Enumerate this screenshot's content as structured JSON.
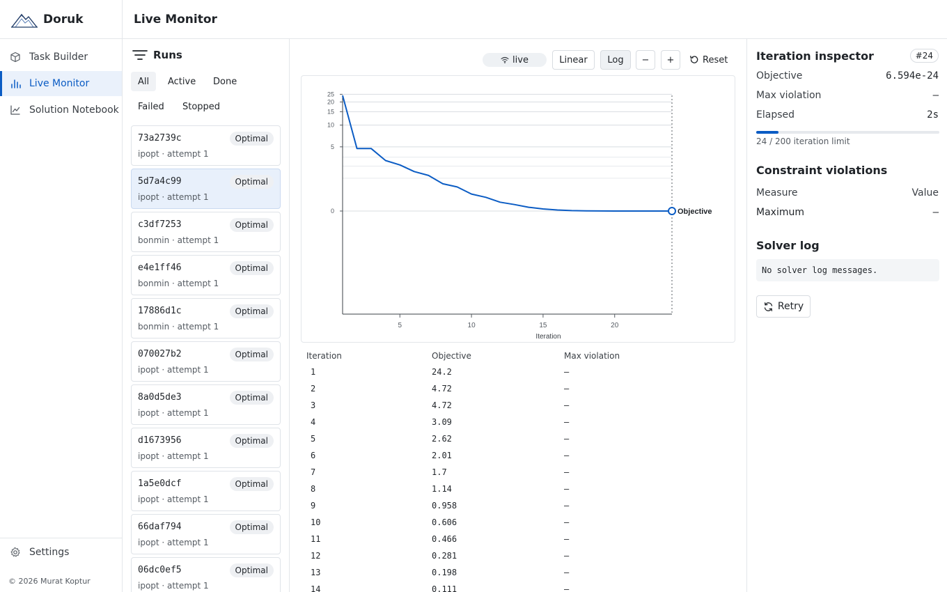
{
  "app": {
    "name": "Doruk"
  },
  "nav": {
    "items": [
      {
        "label": "Task Builder",
        "icon": "cube-icon"
      },
      {
        "label": "Live Monitor",
        "icon": "bar-chart-icon"
      },
      {
        "label": "Solution Notebook",
        "icon": "line-chart-icon"
      }
    ],
    "active_index": 1,
    "settings_label": "Settings",
    "copyright": "© 2026 Murat Koptur"
  },
  "header": {
    "title": "Live Monitor"
  },
  "runs": {
    "title": "Runs",
    "filters": [
      "All",
      "Active",
      "Done",
      "Failed",
      "Stopped"
    ],
    "active_filter": "All",
    "selected_index": 1,
    "items": [
      {
        "id": "73a2739c",
        "meta": "ipopt · attempt 1",
        "status": "Optimal"
      },
      {
        "id": "5d7a4c99",
        "meta": "ipopt · attempt 1",
        "status": "Optimal"
      },
      {
        "id": "c3df7253",
        "meta": "bonmin · attempt 1",
        "status": "Optimal"
      },
      {
        "id": "e4e1ff46",
        "meta": "bonmin · attempt 1",
        "status": "Optimal"
      },
      {
        "id": "17886d1c",
        "meta": "bonmin · attempt 1",
        "status": "Optimal"
      },
      {
        "id": "070027b2",
        "meta": "ipopt · attempt 1",
        "status": "Optimal"
      },
      {
        "id": "8a0d5de3",
        "meta": "ipopt · attempt 1",
        "status": "Optimal"
      },
      {
        "id": "d1673956",
        "meta": "ipopt · attempt 1",
        "status": "Optimal"
      },
      {
        "id": "1a5e0dcf",
        "meta": "ipopt · attempt 1",
        "status": "Optimal"
      },
      {
        "id": "66daf794",
        "meta": "ipopt · attempt 1",
        "status": "Optimal"
      },
      {
        "id": "06dc0ef5",
        "meta": "ipopt · attempt 1",
        "status": "Optimal"
      }
    ]
  },
  "toolbar": {
    "live_label": "live",
    "linear_label": "Linear",
    "log_label": "Log",
    "zoom_out_label": "−",
    "zoom_in_label": "+",
    "reset_label": "Reset",
    "scale": "Log"
  },
  "chart_data": {
    "type": "line",
    "xlabel": "Iteration",
    "ylabel": "",
    "x_ticks": [
      5,
      10,
      15,
      20
    ],
    "y_ticks": [
      "0",
      "5",
      "10",
      "15",
      "20",
      "25"
    ],
    "series": [
      {
        "name": "Objective",
        "color": "#0b5cc4",
        "x": [
          1,
          2,
          3,
          4,
          5,
          6,
          7,
          8,
          9,
          10,
          11,
          12,
          13,
          14,
          15,
          16,
          17,
          18,
          19,
          20,
          21,
          22,
          23,
          24
        ],
        "y": [
          24.2,
          4.72,
          4.72,
          3.09,
          2.62,
          2.01,
          1.7,
          1.14,
          0.958,
          0.606,
          0.466,
          0.281,
          0.198,
          0.111,
          0.06,
          0.03,
          0.012,
          0.004,
          0.001,
          0.0002,
          1e-06,
          1e-10,
          1e-18,
          6.594e-24
        ]
      }
    ],
    "x_range": [
      1,
      24
    ],
    "grid": true,
    "end_label": "Objective"
  },
  "table": {
    "headers": [
      "Iteration",
      "Objective",
      "Max violation"
    ],
    "rows": [
      [
        "1",
        "24.2",
        "—"
      ],
      [
        "2",
        "4.72",
        "—"
      ],
      [
        "3",
        "4.72",
        "—"
      ],
      [
        "4",
        "3.09",
        "—"
      ],
      [
        "5",
        "2.62",
        "—"
      ],
      [
        "6",
        "2.01",
        "—"
      ],
      [
        "7",
        "1.7",
        "—"
      ],
      [
        "8",
        "1.14",
        "—"
      ],
      [
        "9",
        "0.958",
        "—"
      ],
      [
        "10",
        "0.606",
        "—"
      ],
      [
        "11",
        "0.466",
        "—"
      ],
      [
        "12",
        "0.281",
        "—"
      ],
      [
        "13",
        "0.198",
        "—"
      ],
      [
        "14",
        "0.111",
        "—"
      ]
    ]
  },
  "inspector": {
    "title": "Iteration inspector",
    "iteration_badge": "#24",
    "objective_label": "Objective",
    "objective_value": "6.594e-24",
    "max_violation_label": "Max violation",
    "max_violation_value": "—",
    "elapsed_label": "Elapsed",
    "elapsed_value": "2s",
    "progress_fraction": 0.12,
    "progress_text": "24 / 200 iteration limit",
    "violations_title": "Constraint violations",
    "measure_header": "Measure",
    "value_header": "Value",
    "maximum_label": "Maximum",
    "maximum_value": "—",
    "log_title": "Solver log",
    "log_text": "No solver log messages.",
    "retry_label": "Retry"
  },
  "colors": {
    "accent": "#0b5cc4",
    "selected_bg": "#e8f0fb"
  }
}
